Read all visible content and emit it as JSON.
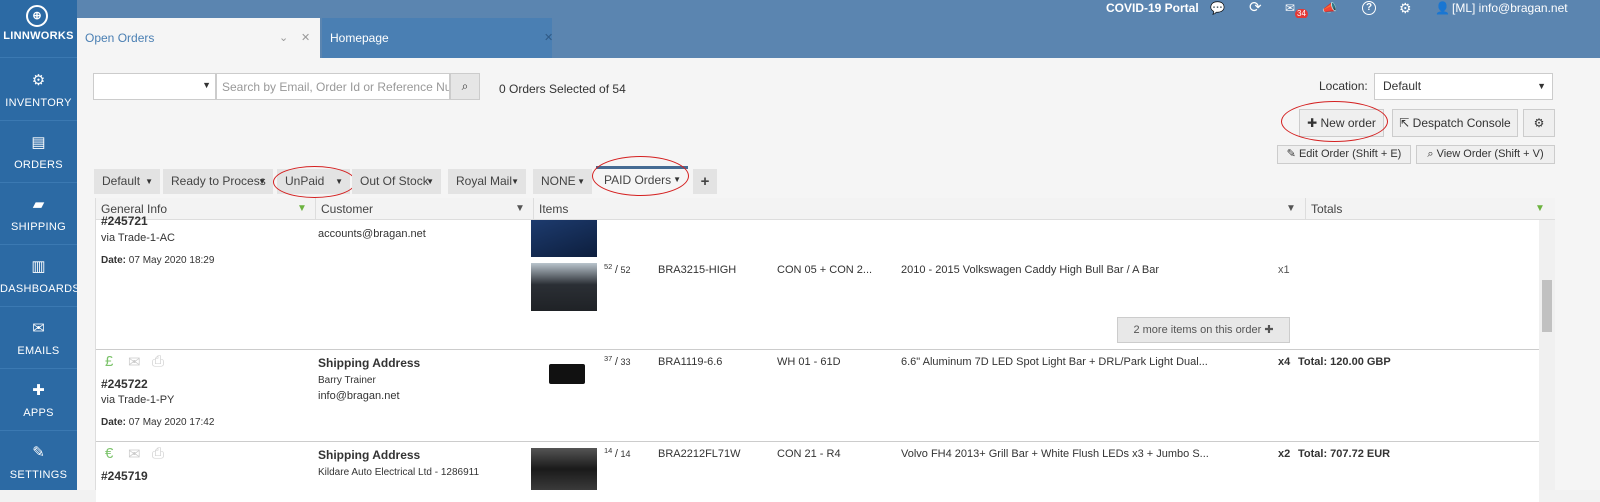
{
  "app": {
    "logo_label": "LINNWORKS",
    "logo_glyph": "⊕"
  },
  "sidebar": {
    "items": [
      {
        "label": "INVENTORY",
        "icon": "cubes-icon",
        "glyph": "⚙"
      },
      {
        "label": "ORDERS",
        "icon": "book-icon",
        "glyph": "▤"
      },
      {
        "label": "SHIPPING",
        "icon": "truck-icon",
        "glyph": "▰"
      },
      {
        "label": "DASHBOARDS",
        "icon": "bar-chart-icon",
        "glyph": "▥"
      },
      {
        "label": "EMAILS",
        "icon": "envelope-icon",
        "glyph": "✉"
      },
      {
        "label": "APPS",
        "icon": "puzzle-icon",
        "glyph": "✚"
      },
      {
        "label": "SETTINGS",
        "icon": "wrench-icon",
        "glyph": "✎"
      }
    ]
  },
  "topbar": {
    "portal": "COVID-19 Portal",
    "mail_badge": "34",
    "user": "[ML] info@bragan.net",
    "icons": {
      "chat": "💬",
      "refresh": "⟳",
      "mail": "✉",
      "megaphone": "📣",
      "help": "?",
      "settings": "⚙",
      "user": "👤"
    }
  },
  "tabs": [
    {
      "label": "Open Orders",
      "chevron": "⌄",
      "close": "✕"
    },
    {
      "label": "Homepage",
      "close": "✕"
    }
  ],
  "toolbar": {
    "search_placeholder": "Search by Email, Order Id or Reference Number",
    "search_icon": "⌕",
    "selected_text": "0 Orders Selected of 54",
    "location_label": "Location:",
    "location_value": "Default",
    "new_order": "New order",
    "new_order_icon": "✚",
    "despatch_console": "Despatch Console",
    "despatch_icon": "⇱",
    "settings_icon": "⚙",
    "edit_order": "Edit Order (Shift + E)",
    "edit_icon": "✎",
    "view_order": "View Order (Shift + V)",
    "view_icon": "⌕",
    "caret": "▼"
  },
  "filter_tabs": [
    {
      "label": "Default"
    },
    {
      "label": "Ready to Process"
    },
    {
      "label": "UnPaid"
    },
    {
      "label": "Out Of Stock"
    },
    {
      "label": "Royal Mail"
    },
    {
      "label": "NONE"
    },
    {
      "label": "PAID Orders"
    }
  ],
  "add_tab": "+",
  "grid": {
    "headers": [
      "General Info",
      "Customer",
      "Items",
      "Totals"
    ],
    "filter_icon": "▼",
    "rows": [
      {
        "order_id": "#245721",
        "via": "via Trade-1-AC",
        "date_label": "Date:",
        "date": "07 May 2020 18:29",
        "email": "accounts@bragan.net",
        "item": {
          "qty_a": "52",
          "qty_sep": "/",
          "qty_b": "52",
          "sku": "BRA3215-HIGH",
          "location": "CON 05 + CON 2...",
          "title": "2010 - 2015 Volkswagen Caddy High Bull Bar / A Bar",
          "count": "x1"
        },
        "more_items": "2 more items on this order",
        "more_icon": "✚"
      },
      {
        "currency_icon": "£",
        "order_id": "#245722",
        "via": "via Trade-1-PY",
        "date_label": "Date:",
        "date": "07 May 2020 17:42",
        "ship_label": "Shipping Address",
        "name": "Barry Trainer",
        "email": "info@bragan.net",
        "item": {
          "qty_a": "37",
          "qty_sep": "/",
          "qty_b": "33",
          "sku": "BRA1119-6.6",
          "location": "WH 01 - 61D",
          "title": "6.6\" Aluminum 7D LED Spot Light Bar + DRL/Park Light Dual...",
          "count": "x4"
        },
        "total": "Total: 120.00 GBP"
      },
      {
        "currency_icon": "€",
        "order_id": "#245719",
        "ship_label": "Shipping Address",
        "name": "Kildare Auto Electrical Ltd - 1286911",
        "item": {
          "qty_a": "14",
          "qty_sep": "/",
          "qty_b": "14",
          "sku": "BRA2212FL71W",
          "location": "CON 21 - R4",
          "title": "Volvo FH4 2013+ Grill Bar + White Flush LEDs x3 + Jumbo S...",
          "count": "x2"
        },
        "total": "Total: 707.72 EUR"
      }
    ]
  },
  "row_icons": {
    "mail": "✉",
    "print": "⎙"
  }
}
